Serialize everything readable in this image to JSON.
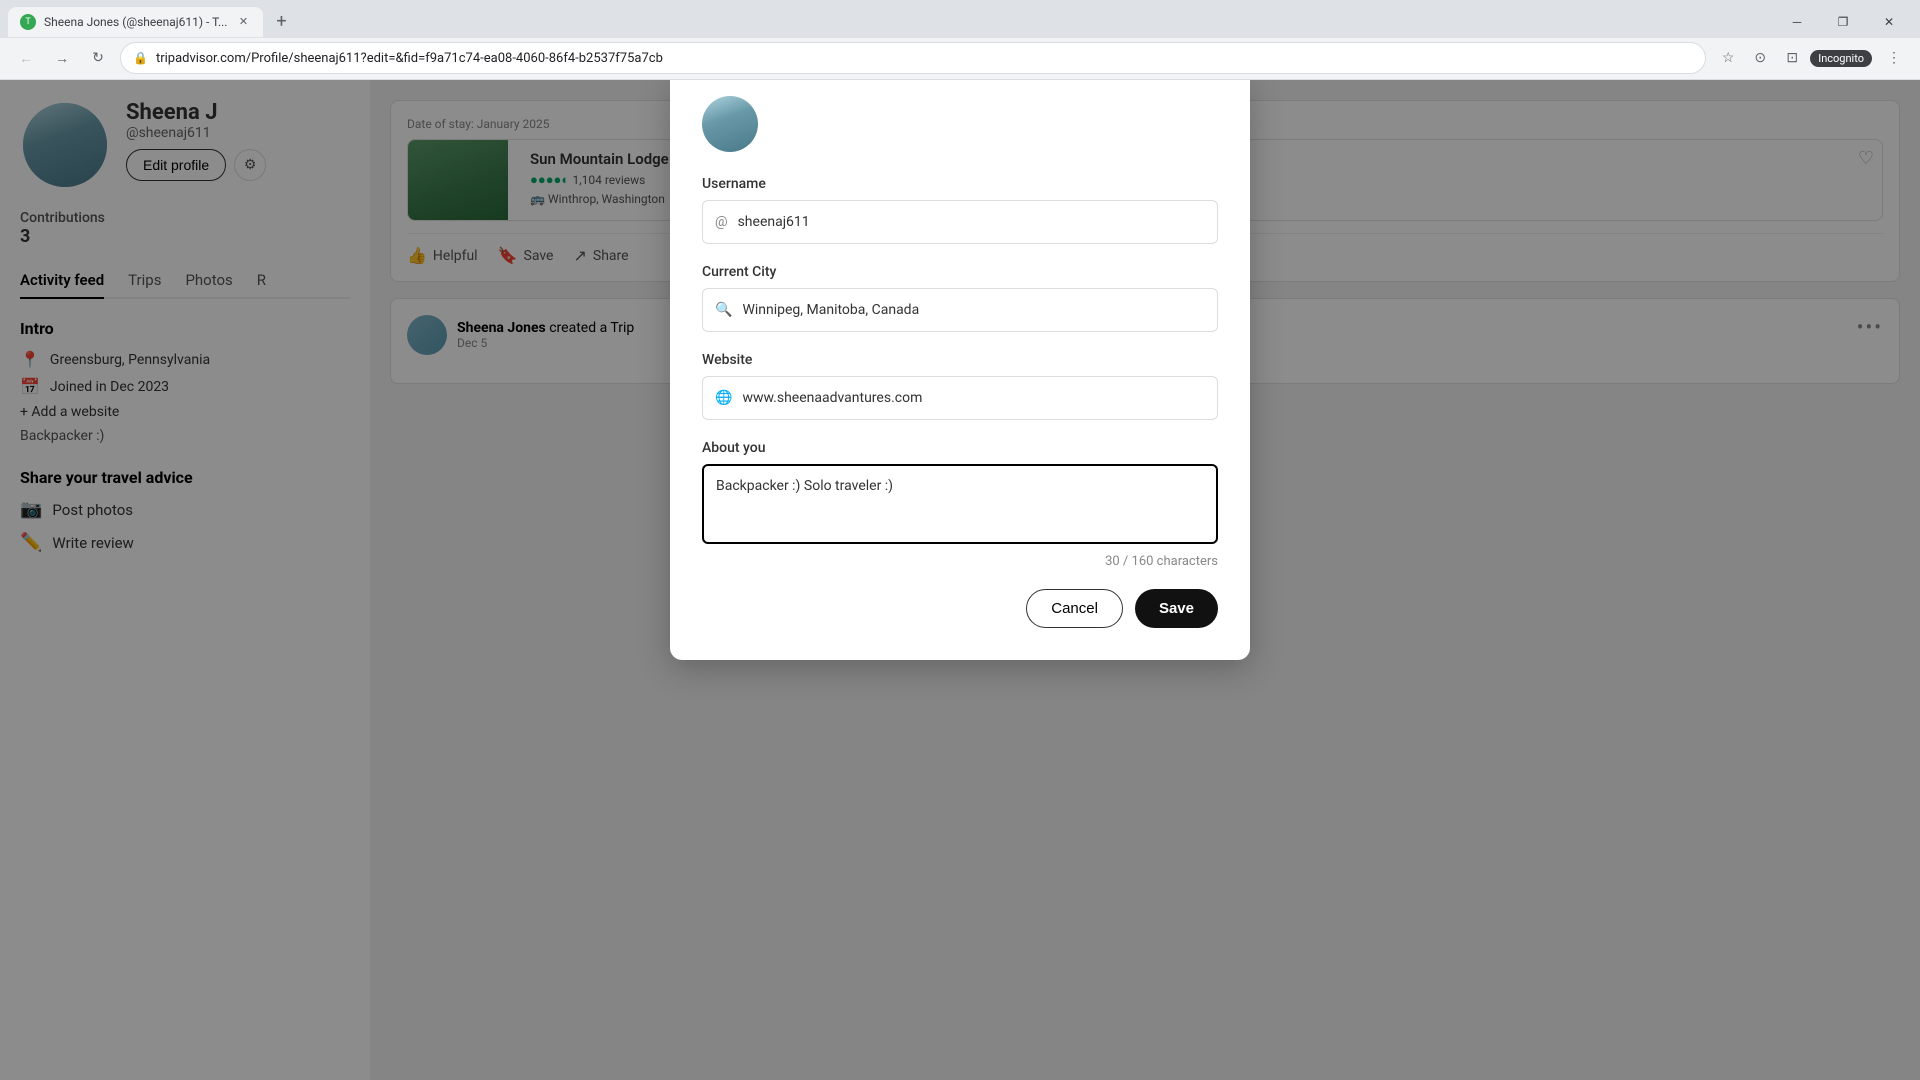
{
  "browser": {
    "tab_title": "Sheena Jones (@sheenaj611) - T...",
    "tab_favicon": "T",
    "address": "tripadvisor.com/Profile/sheenaj611?edit=&fid=f9a71c74-ea08-4060-86f4-b2537f75a7cb",
    "incognito_label": "Incognito"
  },
  "profile": {
    "name": "Sheena J",
    "username": "@sheenaj611",
    "contributions_label": "Contributions",
    "contributions_count": "3",
    "edit_profile_label": "Edit profile"
  },
  "nav_tabs": [
    {
      "label": "Activity feed",
      "active": true
    },
    {
      "label": "Trips",
      "active": false
    },
    {
      "label": "Photos",
      "active": false
    },
    {
      "label": "R",
      "active": false
    }
  ],
  "intro": {
    "title": "Intro",
    "location": "Greensburg, Pennsylvania",
    "joined": "Joined in Dec 2023",
    "add_website": "+ Add a website",
    "bio": "Backpacker :)"
  },
  "share_section": {
    "title": "Share your travel advice",
    "post_photos": "Post photos",
    "write_review": "Write review"
  },
  "activity_feed": {
    "date_of_stay_label": "Date of stay: January 2025",
    "hotel": {
      "name": "Sun Mountain Lodge",
      "stars": "●●●●◐",
      "reviews": "1,104 reviews",
      "location": "Winthrop, Washington"
    },
    "actions": {
      "helpful": "Helpful",
      "save": "Save",
      "share": "Share"
    },
    "trip_creator": {
      "user": "Sheena Jones",
      "action": "created a Trip",
      "date": "Dec 5",
      "more": "..."
    }
  },
  "modal": {
    "username_label": "Username",
    "username_value": "sheenaj611",
    "current_city_label": "Current City",
    "current_city_value": "Winnipeg, Manitoba, Canada",
    "website_label": "Website",
    "website_value": "www.sheenaadvantures.com",
    "about_you_label": "About you",
    "about_you_value": "Backpacker :) Solo traveler :)",
    "char_count": "30 / 160 characters",
    "cancel_label": "Cancel",
    "save_label": "Save"
  }
}
